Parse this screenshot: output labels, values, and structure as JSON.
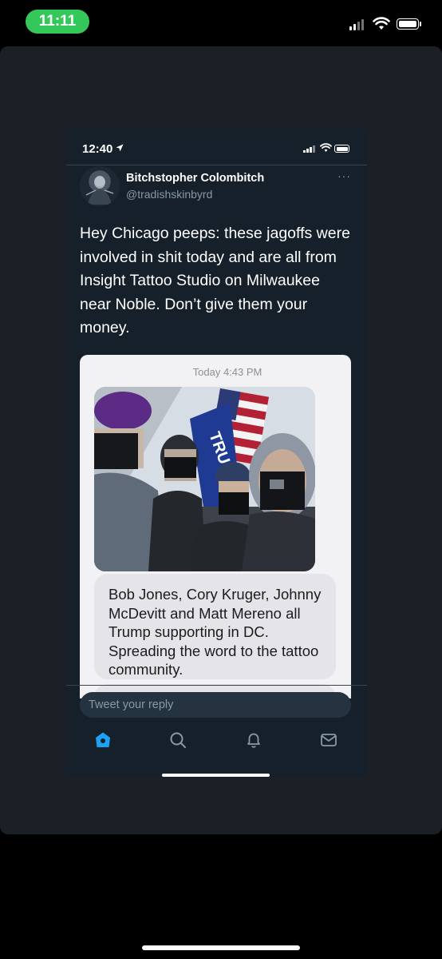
{
  "device": {
    "time": "11:11",
    "inner_time": "12:40"
  },
  "tweet": {
    "display_name": "Bitchstopher Colombitch",
    "handle": "@tradishskinbyrd",
    "more": "···",
    "text": "Hey Chicago peeps: these jagoffs were involved in shit today and are all from Insight Tattoo Studio on Milwaukee near Noble. Don’t give them your money."
  },
  "screenshot": {
    "timestamp": "Today 4:43 PM",
    "message": "Bob Jones, Cory Kruger, Johnny McDevitt and Matt Mereno all Trump supporting in DC. Spreading the word to the tattoo community.",
    "photo_flag_text": "TRU"
  },
  "reply": {
    "placeholder": "Tweet your reply"
  },
  "tabs": [
    {
      "icon": "home-icon",
      "active": true
    },
    {
      "icon": "search-icon",
      "active": false
    },
    {
      "icon": "bell-icon",
      "active": false
    },
    {
      "icon": "mail-icon",
      "active": false
    }
  ],
  "colors": {
    "accent": "#1da1f2",
    "status_pill": "#34c759",
    "background": "#15202b"
  }
}
